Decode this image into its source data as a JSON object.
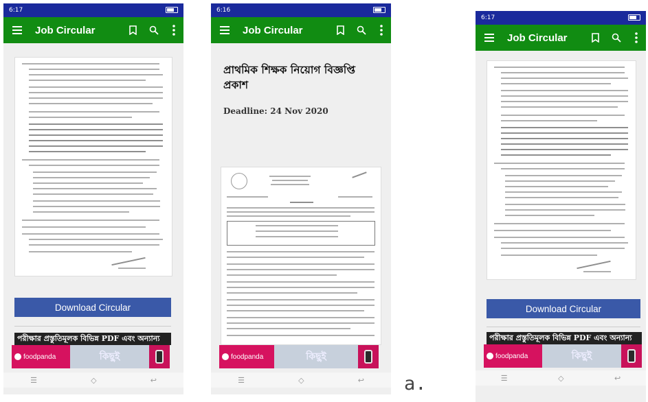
{
  "app": {
    "title": "Job Circular",
    "menu_icon": "menu-icon",
    "bookmark_icon": "bookmark-icon",
    "search_icon": "search-icon",
    "more_icon": "more-vertical-icon",
    "appbar_color": "#118c12",
    "statusbar_color": "#1a2a9c"
  },
  "screens": [
    {
      "status_time": "6:17",
      "download_label": "Download Circular",
      "banner_text": "পরীক্ষার প্রস্তুতিমূলক বিভিন্ন PDF এবং অন্যান্য"
    },
    {
      "status_time": "6:16",
      "headline": "প্রাথমিক শিক্ষক নিয়োগ বিজ্ঞপ্তি প্রকাশ",
      "deadline": "Deadline: 24 Nov 2020"
    },
    {
      "status_time": "6:17",
      "download_label": "Download Circular",
      "banner_text": "পরীক্ষার প্রস্তুতিমূলক বিভিন্ন PDF এবং অন্যান্য"
    }
  ],
  "ad": {
    "brand": "foodpanda",
    "middle_text": "কিছুই"
  },
  "caption": "a."
}
